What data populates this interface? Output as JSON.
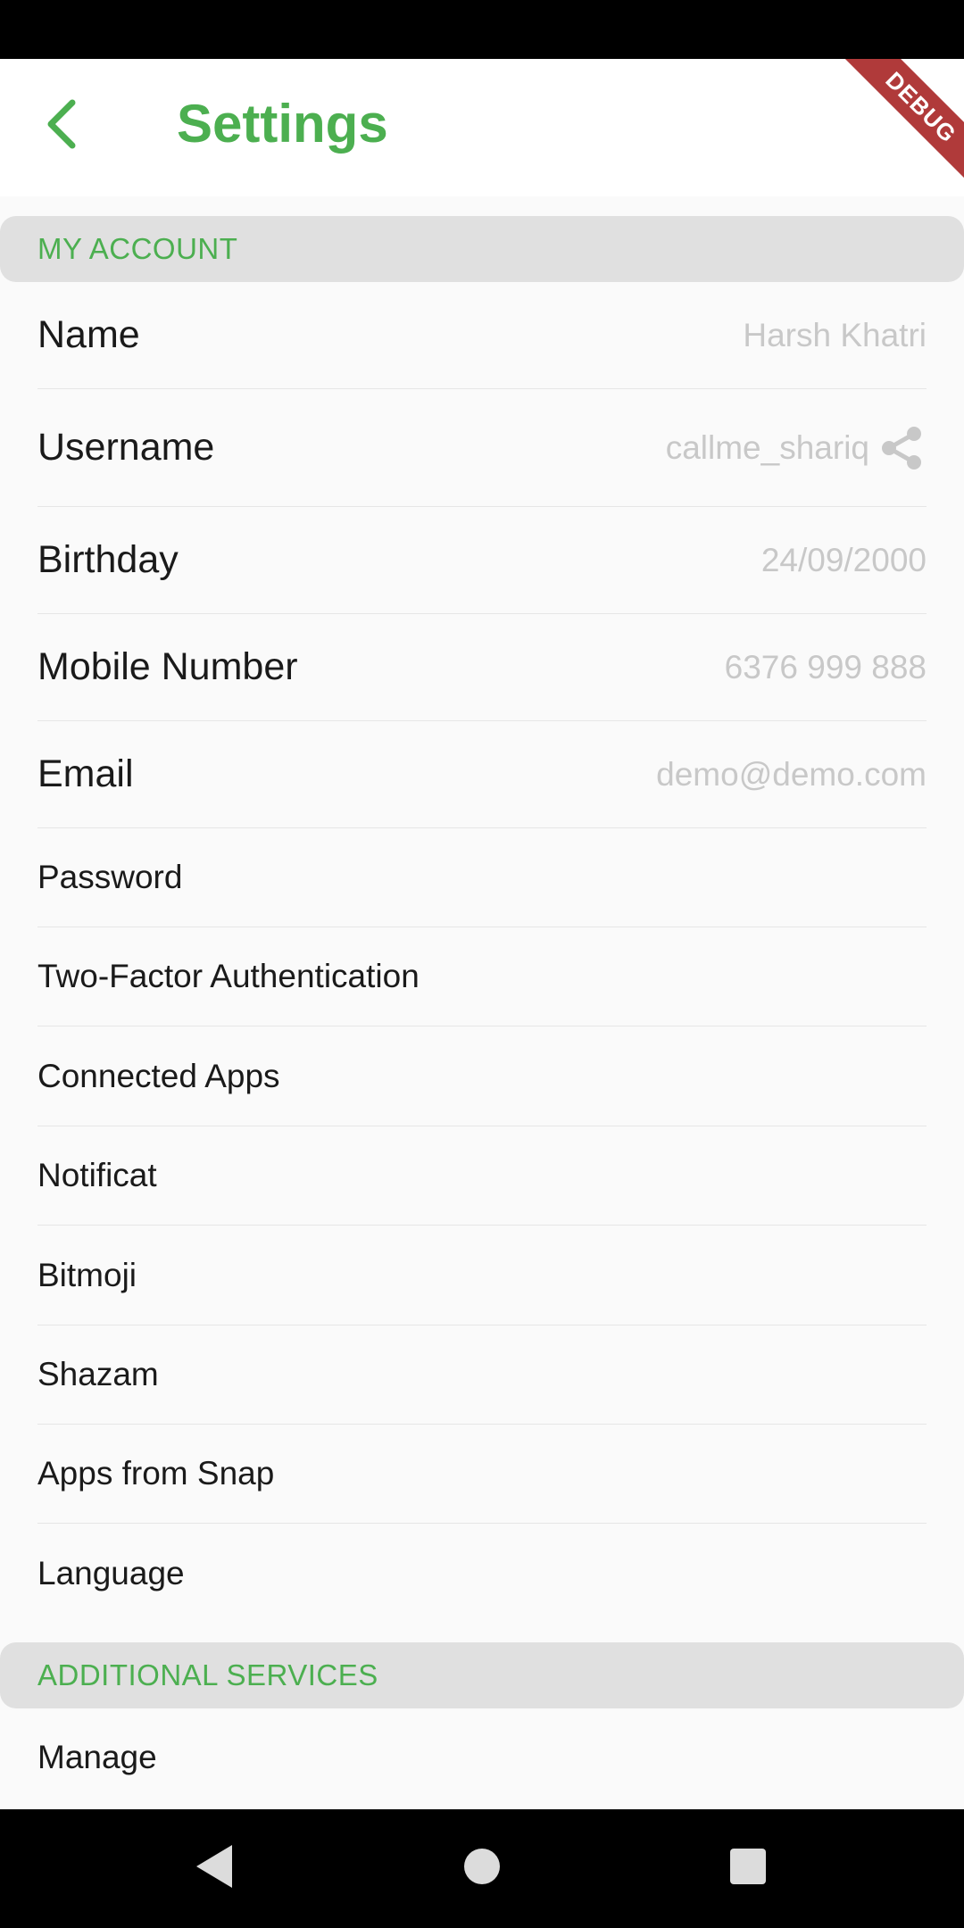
{
  "header": {
    "title": "Settings",
    "debug_banner": "DEBUG"
  },
  "sections": [
    {
      "title": "MY ACCOUNT"
    },
    {
      "title": "ADDITIONAL SERVICES"
    }
  ],
  "my_account": {
    "name": {
      "label": "Name",
      "value": "Harsh Khatri"
    },
    "username": {
      "label": "Username",
      "value": "callme_shariq"
    },
    "birthday": {
      "label": "Birthday",
      "value": "24/09/2000"
    },
    "mobile": {
      "label": "Mobile Number",
      "value": "6376 999 888"
    },
    "email": {
      "label": "Email",
      "value": "demo@demo.com"
    },
    "password": {
      "label": "Password"
    },
    "two_factor": {
      "label": "Two-Factor Authentication"
    },
    "connected_apps": {
      "label": "Connected Apps"
    },
    "notifications": {
      "label": "Notificat"
    },
    "bitmoji": {
      "label": "Bitmoji"
    },
    "shazam": {
      "label": "Shazam"
    },
    "apps_from_snap": {
      "label": "Apps from Snap"
    },
    "language": {
      "label": "Language"
    }
  },
  "additional_services": {
    "manage": {
      "label": "Manage"
    }
  },
  "icons": {
    "back": "chevron-left-icon",
    "share": "share-icon",
    "nav_back": "triangle-back-icon",
    "nav_home": "circle-home-icon",
    "nav_recents": "square-recents-icon"
  },
  "colors": {
    "accent": "#4CAF50",
    "section_bg": "#e0e0e0",
    "value_text": "#c8c8c8",
    "debug_banner": "#b03a3a"
  }
}
